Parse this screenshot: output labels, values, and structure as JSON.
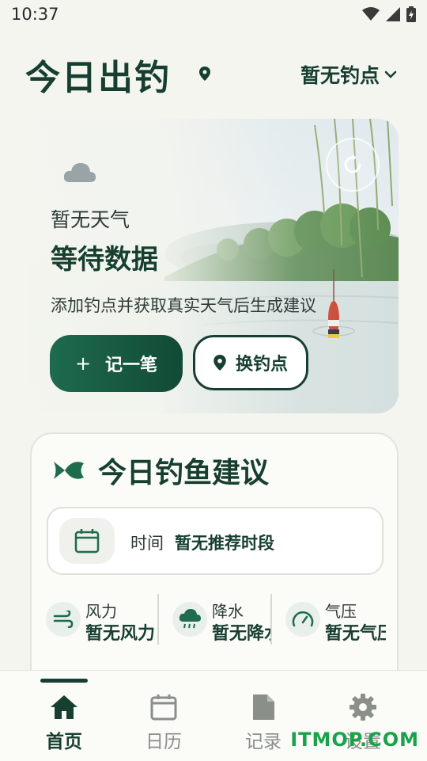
{
  "status_bar": {
    "time": "10:37"
  },
  "header": {
    "title": "今日出钓",
    "spot_selector": "暂无钓点"
  },
  "hero": {
    "weather_label": "暂无天气",
    "weather_main": "等待数据",
    "weather_hint": "添加钓点并获取真实天气后生成建议",
    "record_button": "记一笔",
    "change_spot_button": "换钓点"
  },
  "advice": {
    "title": "今日钓鱼建议",
    "time_label": "时间",
    "time_value": "暂无推荐时段",
    "metrics": [
      {
        "label": "风力",
        "value": "暂无风力"
      },
      {
        "label": "降水",
        "value": "暂无降水"
      },
      {
        "label": "气压",
        "value": "暂无气压"
      }
    ]
  },
  "bottom_nav": {
    "items": [
      {
        "label": "首页"
      },
      {
        "label": "日历"
      },
      {
        "label": "记录"
      },
      {
        "label": "设置"
      }
    ],
    "active": "首页"
  },
  "watermark": "ITMOP.COM",
  "colors": {
    "primary": "#173f31",
    "accent": "#1e6b4e",
    "background": "#f4f5ef",
    "watermark": "#1aa24a"
  }
}
